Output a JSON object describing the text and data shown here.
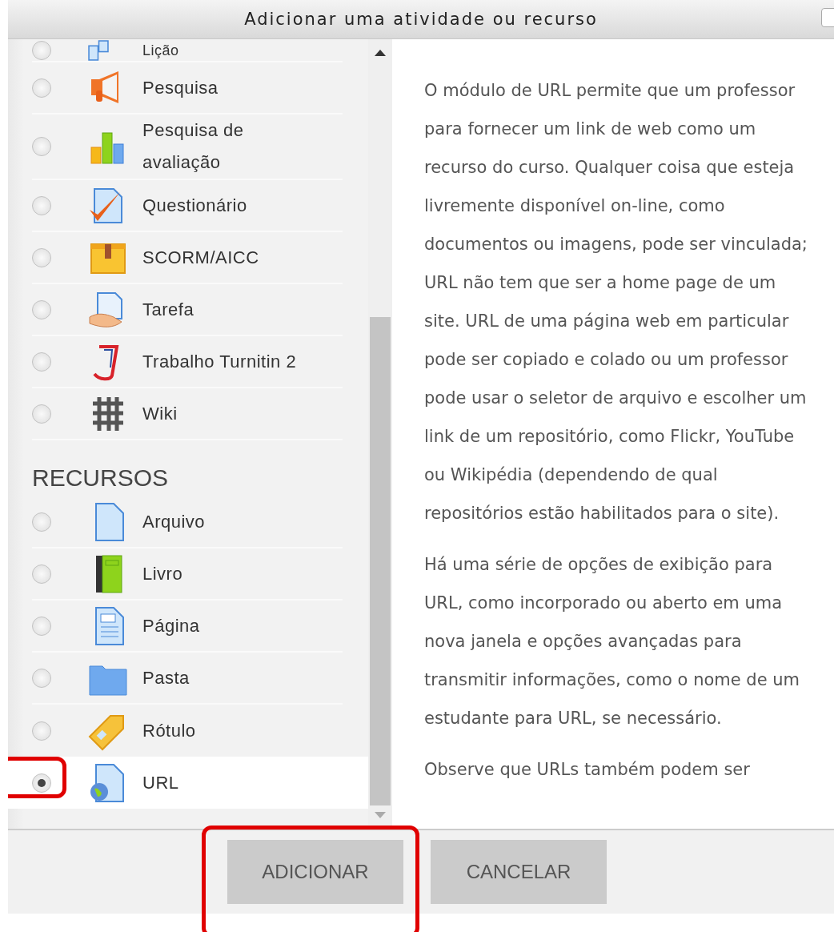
{
  "dialog": {
    "title": "Adicionar uma atividade ou recurso"
  },
  "activities": [
    {
      "label": "Lição",
      "selected": false
    },
    {
      "label": "Pesquisa",
      "selected": false
    },
    {
      "label": "Pesquisa de avaliação",
      "selected": false
    },
    {
      "label": "Questionário",
      "selected": false
    },
    {
      "label": "SCORM/AICC",
      "selected": false
    },
    {
      "label": "Tarefa",
      "selected": false
    },
    {
      "label": "Trabalho Turnitin 2",
      "selected": false
    },
    {
      "label": "Wiki",
      "selected": false
    }
  ],
  "resources": {
    "heading": "RECURSOS",
    "items": [
      {
        "label": "Arquivo",
        "selected": false,
        "highlighted": false
      },
      {
        "label": "Livro",
        "selected": false,
        "highlighted": false
      },
      {
        "label": "Página",
        "selected": false,
        "highlighted": false
      },
      {
        "label": "Pasta",
        "selected": false,
        "highlighted": false
      },
      {
        "label": "Rótulo",
        "selected": false,
        "highlighted": false
      },
      {
        "label": "URL",
        "selected": true,
        "highlighted": true
      }
    ]
  },
  "description": [
    "O módulo de URL permite que um professor para fornecer um link de web como um recurso do curso. Qualquer coisa que esteja livremente disponível on-line, como documentos ou imagens, pode ser vinculada; URL não tem que ser a home page de um site. URL de uma página web em particular pode ser copiado e colado ou um professor pode usar o seletor de arquivo e escolher um link de um repositório, como Flickr, YouTube ou Wikipédia (dependendo de qual repositórios estão habilitados para o site).",
    "Há uma série de opções de exibição para URL, como incorporado ou aberto em uma nova janela e opções avançadas para transmitir informações, como o nome de um estudante para URL, se necessário.",
    "Observe que URLs também podem ser"
  ],
  "buttons": [
    {
      "label": "ADICIONAR",
      "highlighted": true
    },
    {
      "label": "CANCELAR",
      "highlighted": false
    }
  ]
}
